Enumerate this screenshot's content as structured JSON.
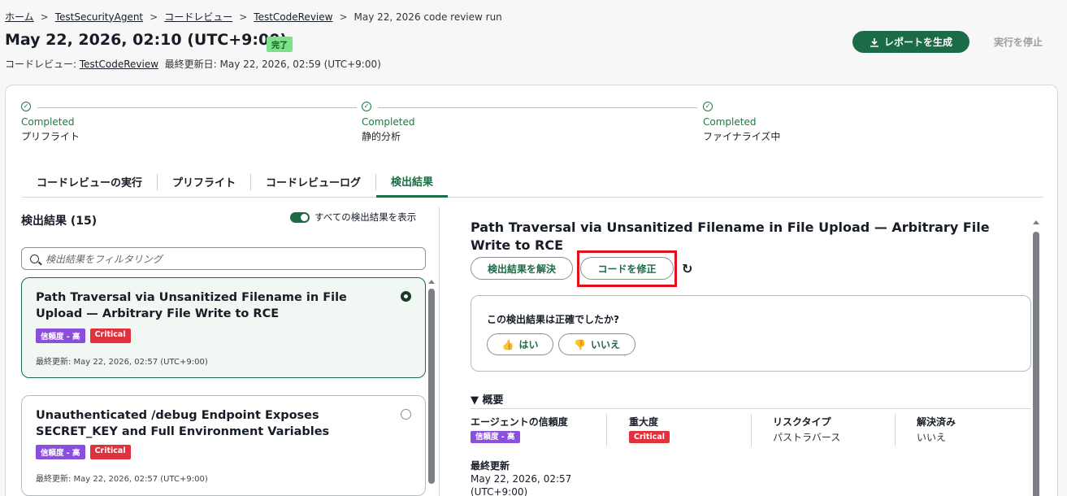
{
  "breadcrumb": {
    "home": "ホーム",
    "agent": "TestSecurityAgent",
    "code_review": "コードレビュー",
    "review_name": "TestCodeReview",
    "current": "May 22, 2026 code review run",
    "separator": ">"
  },
  "header": {
    "title": "May 22, 2026, 02:10 (UTC+9:00)",
    "status_badge": "完了",
    "subtitle_prefix": "コードレビュー: ",
    "subtitle_link": "TestCodeReview",
    "subtitle_updated": "最終更新日: May 22, 2026, 02:59 (UTC+9:00)",
    "report_button": "レポートを生成",
    "stop_button": "実行を停止"
  },
  "steps": [
    {
      "status": "Completed",
      "name": "プリフライト"
    },
    {
      "status": "Completed",
      "name": "静的分析"
    },
    {
      "status": "Completed",
      "name": "ファイナライズ中"
    }
  ],
  "tabs": [
    {
      "label": "コードレビューの実行"
    },
    {
      "label": "プリフライト"
    },
    {
      "label": "コードレビューログ"
    },
    {
      "label": "検出結果"
    }
  ],
  "findings": {
    "title": "検出結果 (15)",
    "toggle_label": "すべての検出結果を表示",
    "filter_placeholder": "検出結果をフィルタリング",
    "items": [
      {
        "title": "Path Traversal via Unsanitized Filename in File Upload — Arbitrary File Write to RCE",
        "confidence": "信頼度 - 高",
        "severity": "Critical",
        "updated": "最終更新: May 22, 2026, 02:57 (UTC+9:00)",
        "selected": true
      },
      {
        "title": "Unauthenticated /debug Endpoint Exposes SECRET_KEY and Full Environment Variables",
        "confidence": "信頼度 - 高",
        "severity": "Critical",
        "updated": "最終更新: May 22, 2026, 02:57 (UTC+9:00)",
        "selected": false
      }
    ]
  },
  "detail": {
    "title": "Path Traversal via Unsanitized Filename in File Upload — Arbitrary File Write to RCE",
    "resolve_button": "検出結果を解決",
    "fix_button": "コードを修正",
    "feedback_question": "この検出結果は正確でしたか?",
    "yes_button": "はい",
    "no_button": "いいえ",
    "overview_header": "▼ 概要",
    "agent_confidence_label": "エージェントの信頼度",
    "agent_confidence_value": "信頼度 - 高",
    "severity_label": "重大度",
    "severity_value": "Critical",
    "risk_type_label": "リスクタイプ",
    "risk_type_value": "パストラバース",
    "resolved_label": "解決済み",
    "resolved_value": "いいえ",
    "last_updated_label": "最終更新",
    "last_updated_line1": "May 22, 2026, 02:57",
    "last_updated_line2": "(UTC+9:00)"
  },
  "colors": {
    "accent": "#1b6b46",
    "critical": "#e0323c",
    "confidence": "#8a4fdc",
    "highlight": "#e0101c"
  }
}
